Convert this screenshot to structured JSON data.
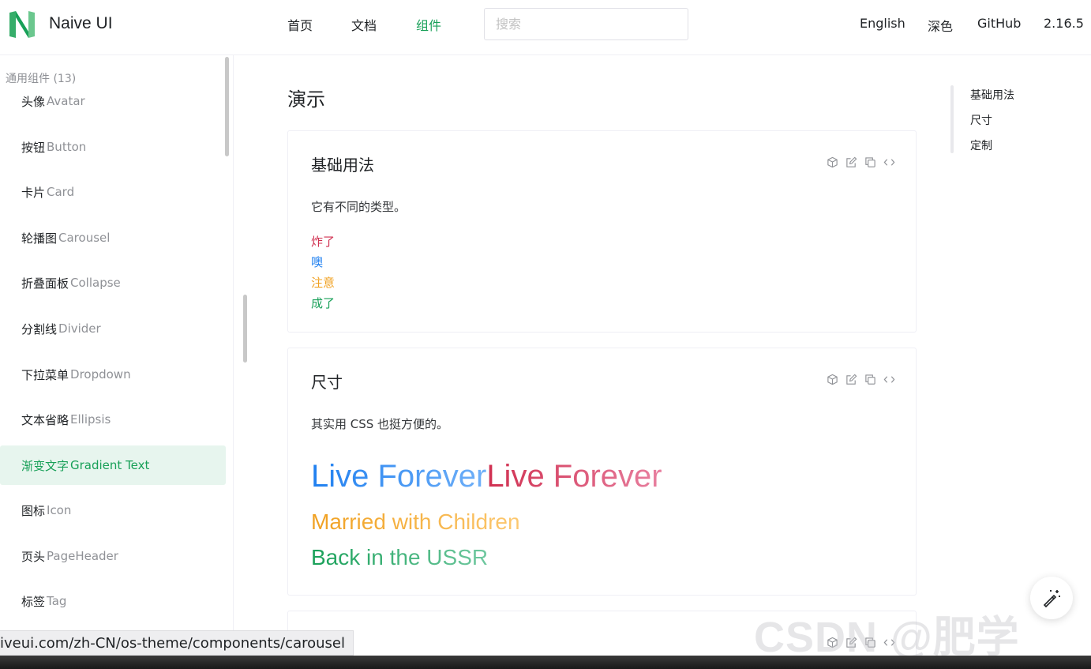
{
  "header": {
    "brand": "Naive UI",
    "nav": [
      "首页",
      "文档",
      "组件"
    ],
    "search_placeholder": "搜索",
    "links": [
      "English",
      "深色",
      "GitHub",
      "2.16.5"
    ]
  },
  "sidebar": {
    "group_title": "通用组件 (13)",
    "items": [
      {
        "zh": "头像",
        "en": "Avatar"
      },
      {
        "zh": "按钮",
        "en": "Button"
      },
      {
        "zh": "卡片",
        "en": "Card"
      },
      {
        "zh": "轮播图",
        "en": "Carousel"
      },
      {
        "zh": "折叠面板",
        "en": "Collapse"
      },
      {
        "zh": "分割线",
        "en": "Divider"
      },
      {
        "zh": "下拉菜单",
        "en": "Dropdown"
      },
      {
        "zh": "文本省略",
        "en": "Ellipsis"
      },
      {
        "zh": "渐变文字",
        "en": "Gradient Text"
      },
      {
        "zh": "图标",
        "en": "Icon"
      },
      {
        "zh": "页头",
        "en": "PageHeader"
      },
      {
        "zh": "标签",
        "en": "Tag"
      }
    ],
    "active_index": 8
  },
  "main": {
    "title": "演示",
    "cards": [
      {
        "title": "基础用法",
        "desc": "它有不同的类型。",
        "lines": [
          {
            "text": "炸了",
            "color": "#d03050"
          },
          {
            "text": "噢",
            "color": "#2080f0"
          },
          {
            "text": "注意",
            "color": "#f0a020"
          },
          {
            "text": "成了",
            "color": "#18a058"
          }
        ]
      },
      {
        "title": "尺寸",
        "desc": "其实用 CSS 也挺方便的。",
        "big_a": "Live Forever",
        "big_b": "Live Forever",
        "mid_a": "Married with Children",
        "mid_b": "Back in the USSR"
      }
    ],
    "tool_icons": [
      "cube-icon",
      "edit-icon",
      "copy-icon",
      "code-icon"
    ]
  },
  "anchors": [
    "基础用法",
    "尺寸",
    "定制"
  ],
  "watermark": "CSDN @肥学",
  "statusbar": "iveui.com/zh-CN/os-theme/components/carousel",
  "colors": {
    "primary": "#18a058",
    "error": "#d03050",
    "info": "#2080f0",
    "warning": "#f0a020"
  }
}
